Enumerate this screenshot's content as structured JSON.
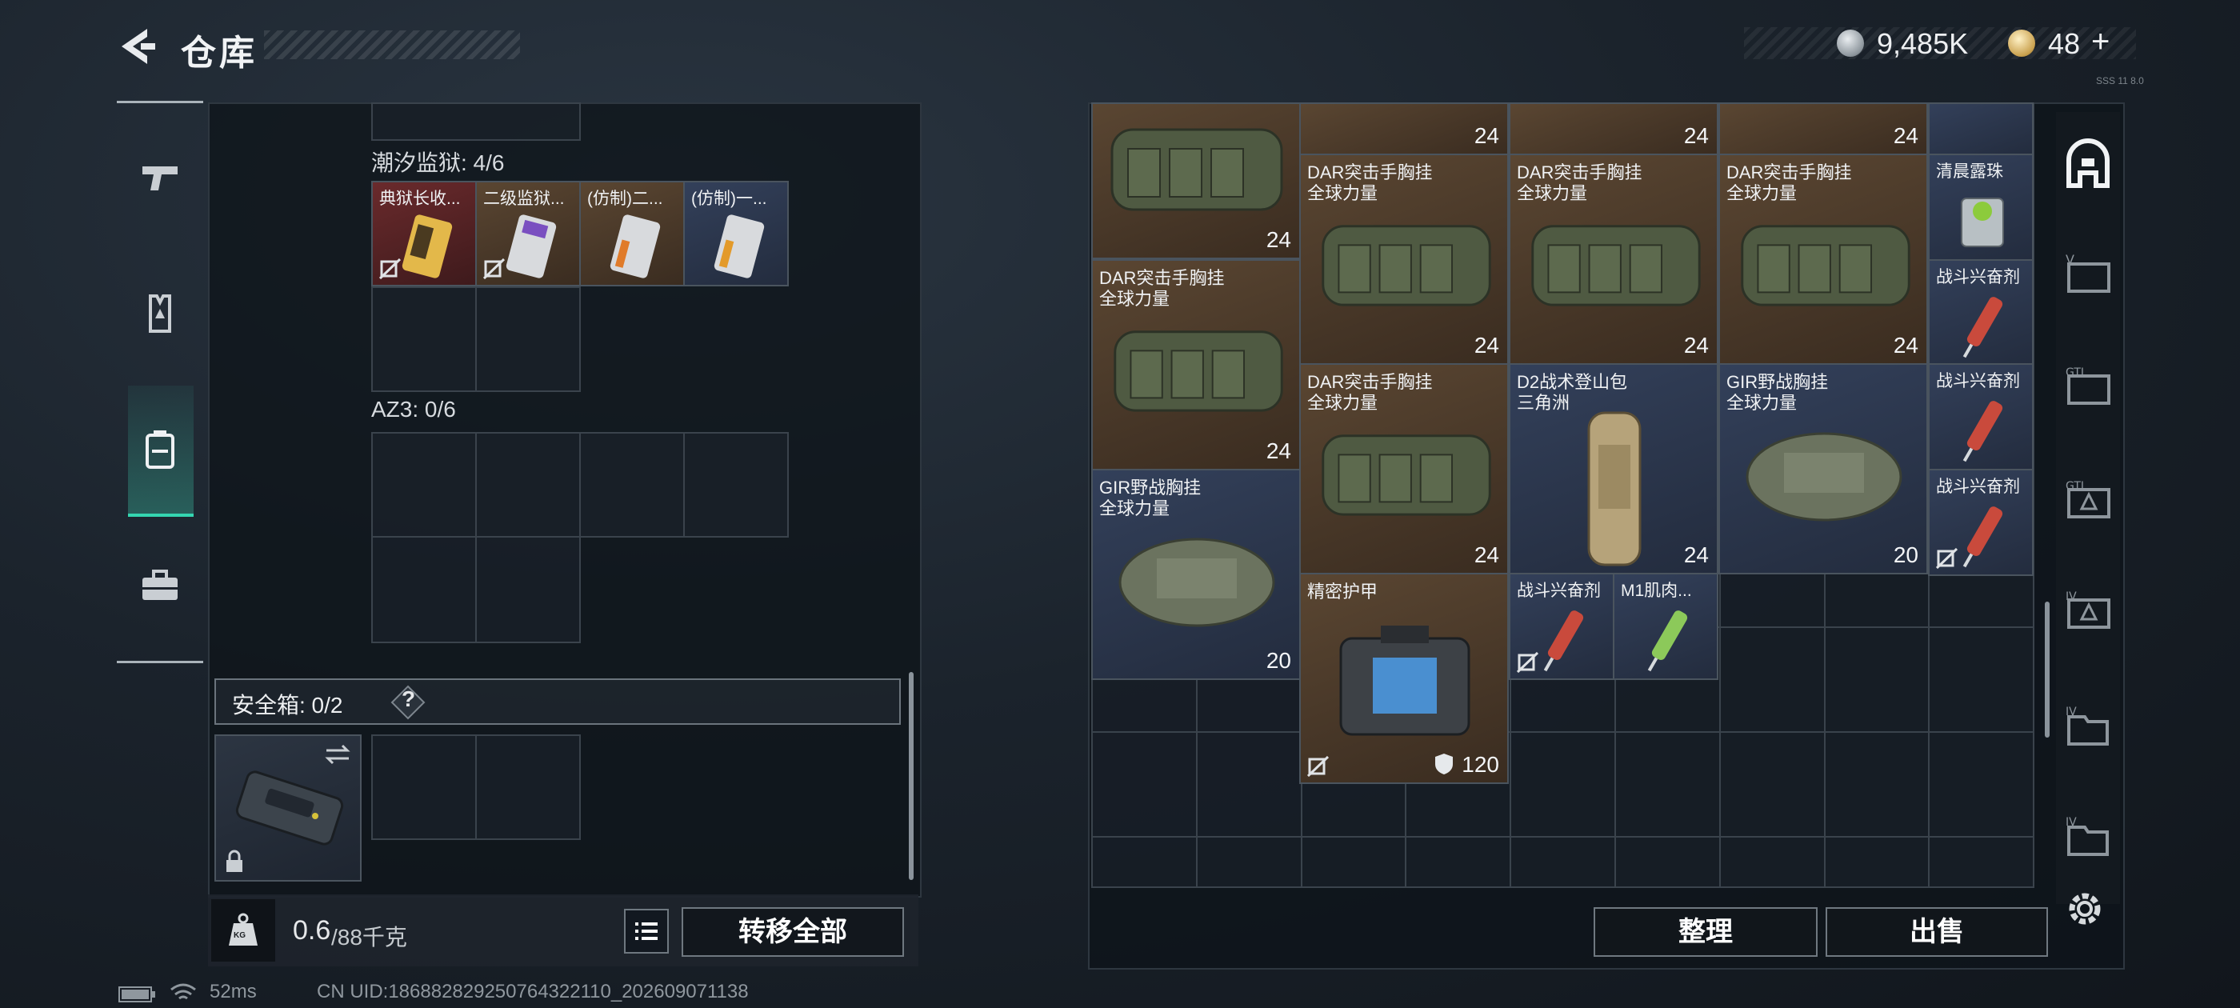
{
  "header": {
    "title": "仓库",
    "currency1": "9,485K",
    "currency2": "48",
    "currency2_plus": "+",
    "version": "SSS 11 8.0"
  },
  "nav": {
    "items": [
      "pistol-icon",
      "armor-vest-icon",
      "backpack-icon",
      "toolbox-icon"
    ],
    "active": "backpack-icon"
  },
  "left": {
    "section1_label": "潮汐监狱: 4/6",
    "section1_items": [
      {
        "name": "典狱长收...",
        "bg": "red"
      },
      {
        "name": "二级监狱...",
        "bg": "brown"
      },
      {
        "name": "(仿制)二...",
        "bg": "brown"
      },
      {
        "name": "(仿制)一...",
        "bg": "blue"
      }
    ],
    "section2_label": "AZ3: 0/6",
    "safebox_label": "安全箱: 0/2",
    "help": "?",
    "weight_value": "0.6",
    "weight_max": "/88千克",
    "weight_icon_label": "KG",
    "transfer_all": "转移全部"
  },
  "right": {
    "items": {
      "bag_top1": {
        "count": "24"
      },
      "top_count2": "24",
      "top_count3": "24",
      "top_count4": "24",
      "dar_a": {
        "name": "DAR突击手胸挂",
        "sub": "全球力量",
        "count": "24"
      },
      "dar_b": {
        "name": "DAR突击手胸挂",
        "sub": "全球力量",
        "count": "24"
      },
      "dar_c": {
        "name": "DAR突击手胸挂",
        "sub": "全球力量",
        "count": "24"
      },
      "dew": {
        "name": "清晨露珠"
      },
      "dar_d": {
        "name": "DAR突击手胸挂",
        "sub": "全球力量",
        "count": "24"
      },
      "stim1": {
        "name": "战斗兴奋剂"
      },
      "dar_e": {
        "name": "DAR突击手胸挂",
        "sub": "全球力量",
        "count": "24"
      },
      "d2": {
        "name": "D2战术登山包",
        "sub": "三角洲",
        "count": "24"
      },
      "gir_a": {
        "name": "GIR野战胸挂",
        "sub": "全球力量",
        "count": "20"
      },
      "stim2": {
        "name": "战斗兴奋剂"
      },
      "gir_b": {
        "name": "GIR野战胸挂",
        "sub": "全球力量",
        "count": "20"
      },
      "stim3": {
        "name": "战斗兴奋剂"
      },
      "armor": {
        "name": "精密护甲",
        "count": "120"
      },
      "stim4": {
        "name": "战斗兴奋剂"
      },
      "m1": {
        "name": "M1肌肉..."
      }
    },
    "sort_button": "整理",
    "sell_button": "出售"
  },
  "status": {
    "ping": "52ms",
    "uid": "CN UID:1868828292507643221­10_202609071138"
  },
  "colors": {
    "accent": "#34d6b1",
    "brown_cell": "#5a4632",
    "blue_cell": "#33405a",
    "red_cell": "#6a2a2c"
  }
}
